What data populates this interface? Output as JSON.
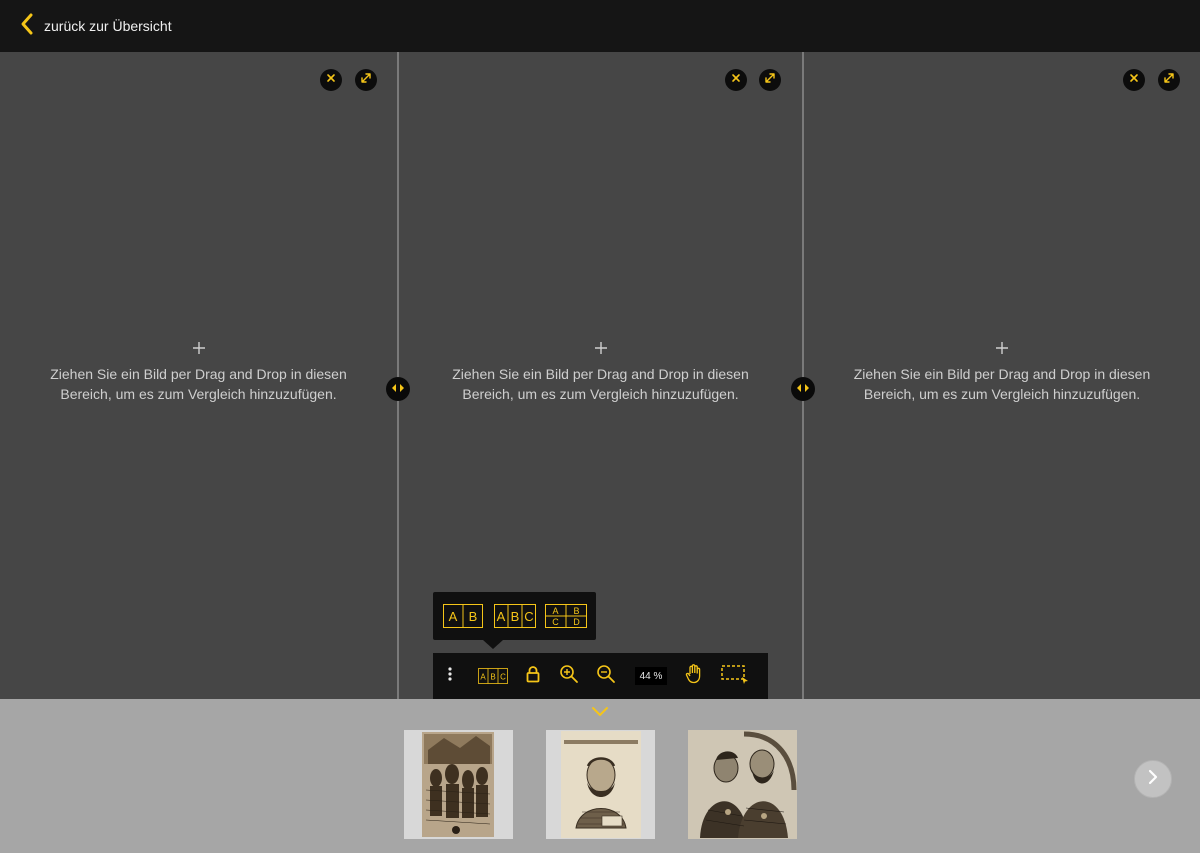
{
  "header": {
    "back_label": "zurück zur Übersicht"
  },
  "panels": [
    {
      "drop_text": "Ziehen Sie ein Bild per Drag and Drop in diesen\nBereich, um es zum Vergleich hinzuzufügen."
    },
    {
      "drop_text": "Ziehen Sie ein Bild per Drag and Drop in diesen\nBereich, um es zum Vergleich hinzuzufügen."
    },
    {
      "drop_text": "Ziehen Sie ein Bild per Drag and Drop in diesen\nBereich, um es zum Vergleich hinzuzufügen."
    }
  ],
  "layout_options": [
    {
      "name": "layout-ab",
      "letters": [
        "A",
        "B"
      ]
    },
    {
      "name": "layout-abc",
      "letters": [
        "A",
        "B",
        "C"
      ]
    },
    {
      "name": "layout-abcd",
      "letters": [
        "A",
        "B",
        "C",
        "D"
      ]
    }
  ],
  "toolbar": {
    "zoom": "44 %",
    "zoom_percent": 44,
    "current_layout_letters": [
      "A",
      "B",
      "C"
    ]
  },
  "tray": {
    "thumbnails": [
      {
        "name": "thumbnail-crowd-scene"
      },
      {
        "name": "thumbnail-bearded-man-portrait"
      },
      {
        "name": "thumbnail-two-men-portrait"
      }
    ]
  },
  "colors": {
    "accent": "#f5c518",
    "topbar": "#151515",
    "panel_bg": "#464646",
    "tray_bg": "#a6a6a6",
    "toolbar_bg": "#101010"
  },
  "icons": {
    "back": "chevron-left-icon",
    "close": "close-icon",
    "expand": "expand-icon",
    "add": "plus-icon",
    "resize": "resize-horizontal-icon",
    "more": "more-vertical-icon",
    "lock": "lock-icon",
    "zoom_in": "zoom-in-icon",
    "zoom_out": "zoom-out-icon",
    "pan": "hand-icon",
    "select": "selection-icon",
    "collapse": "chevron-down-icon",
    "next": "chevron-right-icon"
  }
}
